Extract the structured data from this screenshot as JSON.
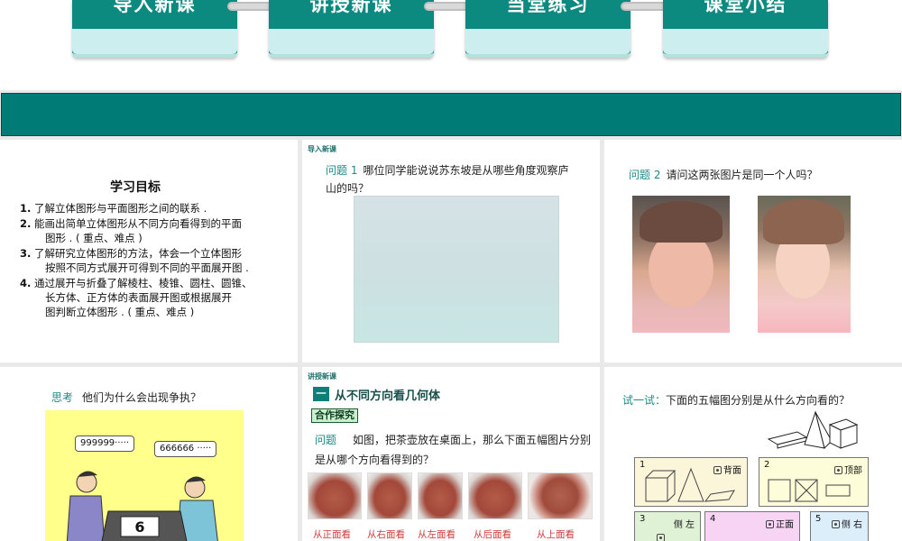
{
  "nav": {
    "tabs": [
      {
        "label": "导入新课"
      },
      {
        "label": "讲授新课"
      },
      {
        "label": "当堂练习"
      },
      {
        "label": "课堂小结"
      }
    ]
  },
  "colors": {
    "teal": "#007b75",
    "accent_text": "#1a8a86",
    "view_label": "#d23a3a"
  },
  "panel1": {
    "title": "学习目标",
    "goals": [
      {
        "num": "1.",
        "text": "了解立体图形与平面图形之间的联系 ."
      },
      {
        "num": "2.",
        "text": "能画出简单立体图形从不同方向看得到的平面",
        "cont": "图形 . ( 重点、难点 )"
      },
      {
        "num": "3.",
        "text": "了解研究立体图形的方法，体会一个立体图形",
        "cont": "按照不同方式展开可得到不同的平面展开图 ."
      },
      {
        "num": "4.",
        "text": "通过展开与折叠了解棱柱、棱锥、圆柱、圆锥、",
        "cont": "长方体、正方体的表面展开图或根据展开",
        "cont2": "图判断立体图形 . ( 重点、难点 )"
      }
    ]
  },
  "panel2": {
    "tag": "导入新课",
    "question_label": "问题 1",
    "question": "哪位同学能说说苏东坡是从哪些角度观察庐山的吗？"
  },
  "panel3": {
    "question_label": "问题 2",
    "question": "请问这两张图片是同一个人吗？"
  },
  "panel4": {
    "think_label": "思考",
    "think_text": "他们为什么会出现争执？",
    "bubble_left": "999999·····",
    "bubble_right": "666666 ·····"
  },
  "panel5": {
    "tag": "讲授新课",
    "section_num": "一",
    "section_title": "从不同方向看几何体",
    "coop": "合作探究",
    "question_label": "问题",
    "question": "如图，把茶壶放在桌面上，那么下面五幅图片分别是从哪个方向看得到的？",
    "views": [
      "从正面看",
      "从右面看",
      "从左面看",
      "从后面看",
      "从上面看"
    ]
  },
  "panel6": {
    "try_label": "试一试：",
    "try_text": "下面的五幅图分别是从什么方向看的？",
    "boxes": [
      {
        "num": "1",
        "label": "背面"
      },
      {
        "num": "2",
        "label": "顶部"
      },
      {
        "num": "3",
        "label": "侧 左"
      },
      {
        "num": "4",
        "label": "正面"
      },
      {
        "num": "5",
        "label": "侧 右"
      }
    ]
  }
}
